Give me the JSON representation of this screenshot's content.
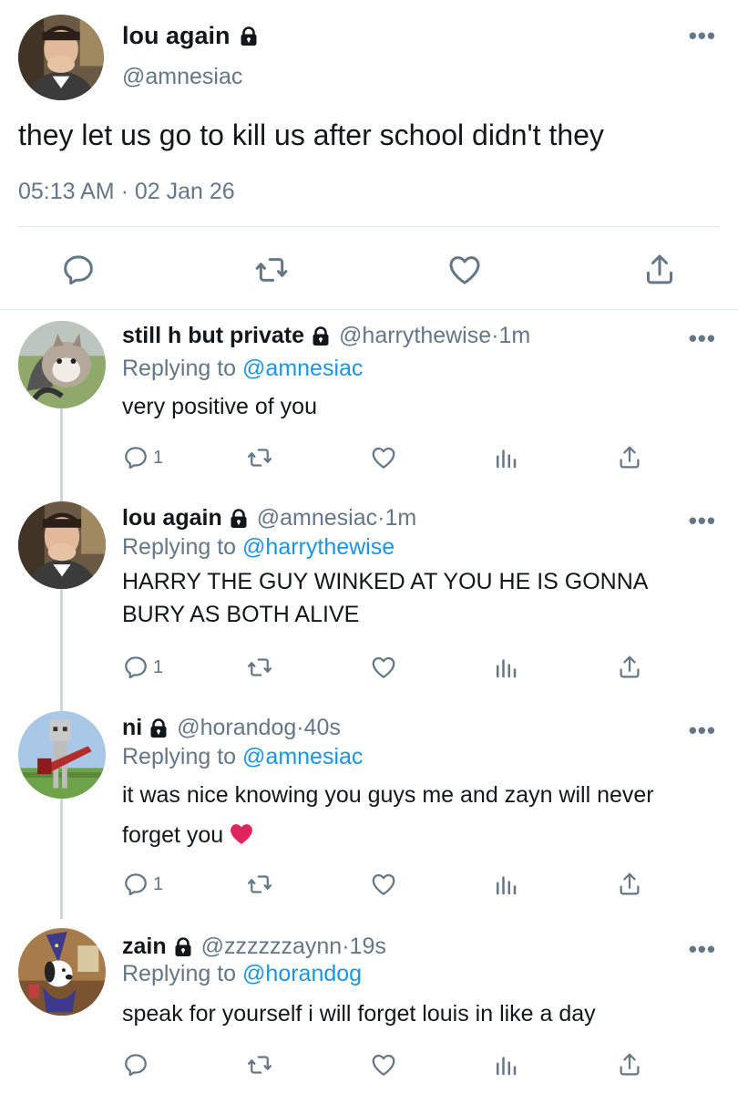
{
  "main_tweet": {
    "name": "lou again",
    "handle": "@amnesiac",
    "text": "they let us go to kill us after school didn't they",
    "timestamp": "05:13 AM · 02 Jan 26"
  },
  "replies": [
    {
      "name": "still h but private",
      "handle": "@harrythewise",
      "time": "1m",
      "replying_prefix": "Replying to ",
      "replying_to": "@amnesiac",
      "text": "very positive of you",
      "reply_count": "1"
    },
    {
      "name": "lou again",
      "handle": "@amnesiac",
      "time": "1m",
      "replying_prefix": "Replying to ",
      "replying_to": "@harrythewise",
      "text": "HARRY THE GUY WINKED AT YOU HE IS GONNA BURY AS BOTH ALIVE",
      "reply_count": "1"
    },
    {
      "name": "ni",
      "handle": "@horandog",
      "time": "40s",
      "replying_prefix": "Replying to ",
      "replying_to": "@amnesiac",
      "text": "it was nice knowing you guys me and zayn will never forget you",
      "reply_count": "1"
    },
    {
      "name": "zain",
      "handle": "@zzzzzzaynn",
      "time": "19s",
      "replying_prefix": "Replying to ",
      "replying_to": "@horandog",
      "text": "speak for yourself i will forget louis in like a day",
      "reply_count": ""
    }
  ],
  "separator": " · ",
  "more_label": "•••",
  "icons": {
    "reply": "reply-icon",
    "retweet": "retweet-icon",
    "like": "heart-icon",
    "analytics": "analytics-icon",
    "share": "share-icon",
    "lock": "lock-icon"
  },
  "colors": {
    "text": "#14171a",
    "secondary": "#657786",
    "link": "#1b95e0",
    "divider": "#e1e8ed",
    "thread": "#ccd6dd",
    "emoji_heart": "#e0245e"
  }
}
